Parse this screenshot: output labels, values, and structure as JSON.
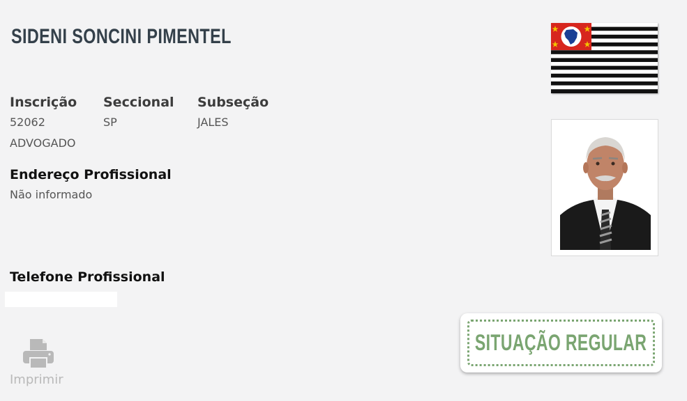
{
  "profile": {
    "name": "SIDENI SONCINI PIMENTEL",
    "fields": [
      {
        "label": "Inscrição",
        "value": "52062"
      },
      {
        "label": "Seccional",
        "value": "SP"
      },
      {
        "label": "Subseção",
        "value": "JALES"
      }
    ],
    "type": "ADVOGADO",
    "address_label": "Endereço Profissional",
    "address_value": "Não informado",
    "phone_label": "Telefone Profissional",
    "phone_value": ""
  },
  "actions": {
    "print_label": "Imprimir"
  },
  "status": {
    "text": "SITUAÇÃO REGULAR",
    "color": "#7aa571"
  },
  "icons": {
    "print": "printer-icon",
    "flag": "sao-paulo-state-flag",
    "photo": "lawyer-photo"
  },
  "colors": {
    "background": "#f3f3f4",
    "name": "#34404a",
    "flag_red": "#d7261e",
    "flag_blue": "#1b3f95"
  }
}
